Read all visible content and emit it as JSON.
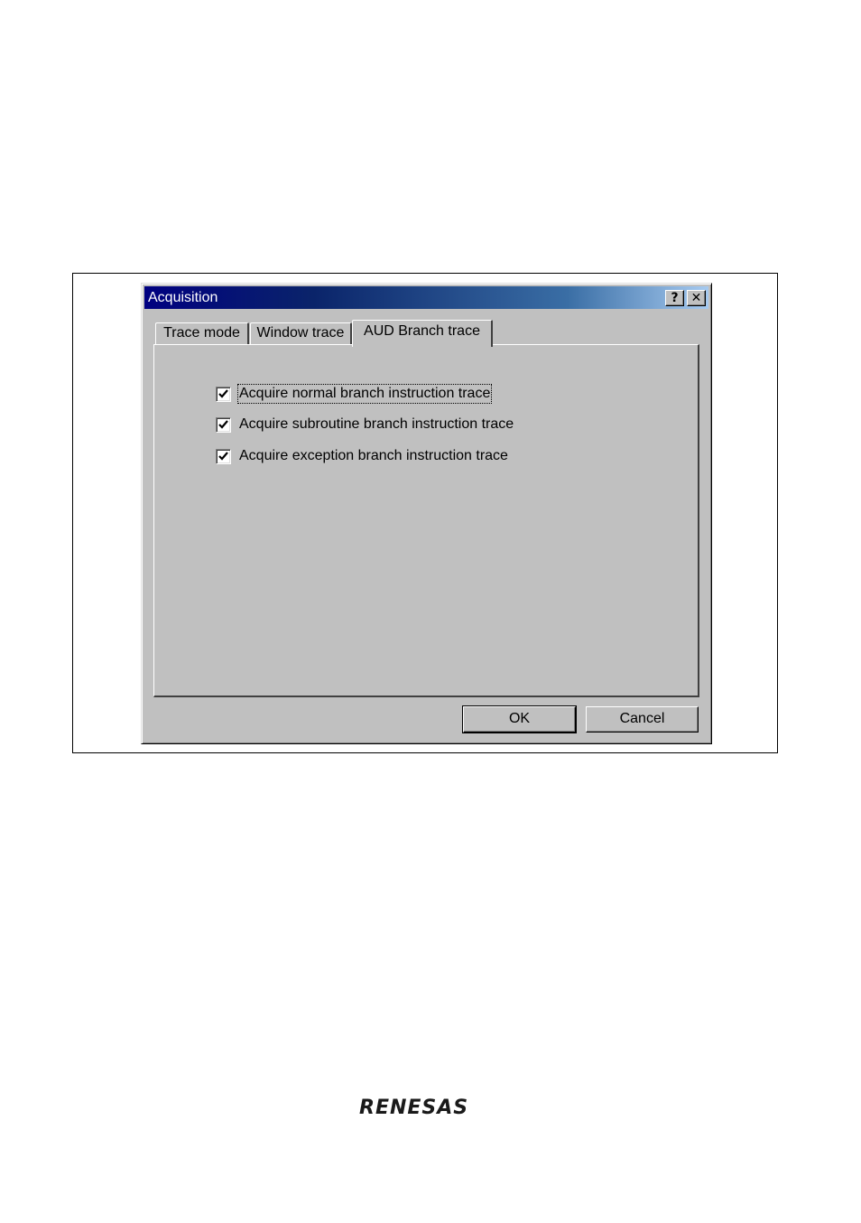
{
  "dialog": {
    "title": "Acquisition",
    "help_button": "?",
    "close_button": "✕"
  },
  "tabs": [
    {
      "label": "Trace mode",
      "active": false
    },
    {
      "label": "Window trace",
      "active": false
    },
    {
      "label": "AUD Branch trace",
      "active": true
    }
  ],
  "options": [
    {
      "label": "Acquire normal branch instruction trace",
      "checked": true,
      "focused": true
    },
    {
      "label": "Acquire subroutine branch instruction trace",
      "checked": true,
      "focused": false
    },
    {
      "label": "Acquire exception branch instruction trace",
      "checked": true,
      "focused": false
    }
  ],
  "buttons": {
    "ok": "OK",
    "cancel": "Cancel"
  },
  "footer": {
    "logo": "RENESAS"
  },
  "colors": {
    "face": "#c0c0c0",
    "title_start": "#000080",
    "title_end": "#a6caf0"
  }
}
